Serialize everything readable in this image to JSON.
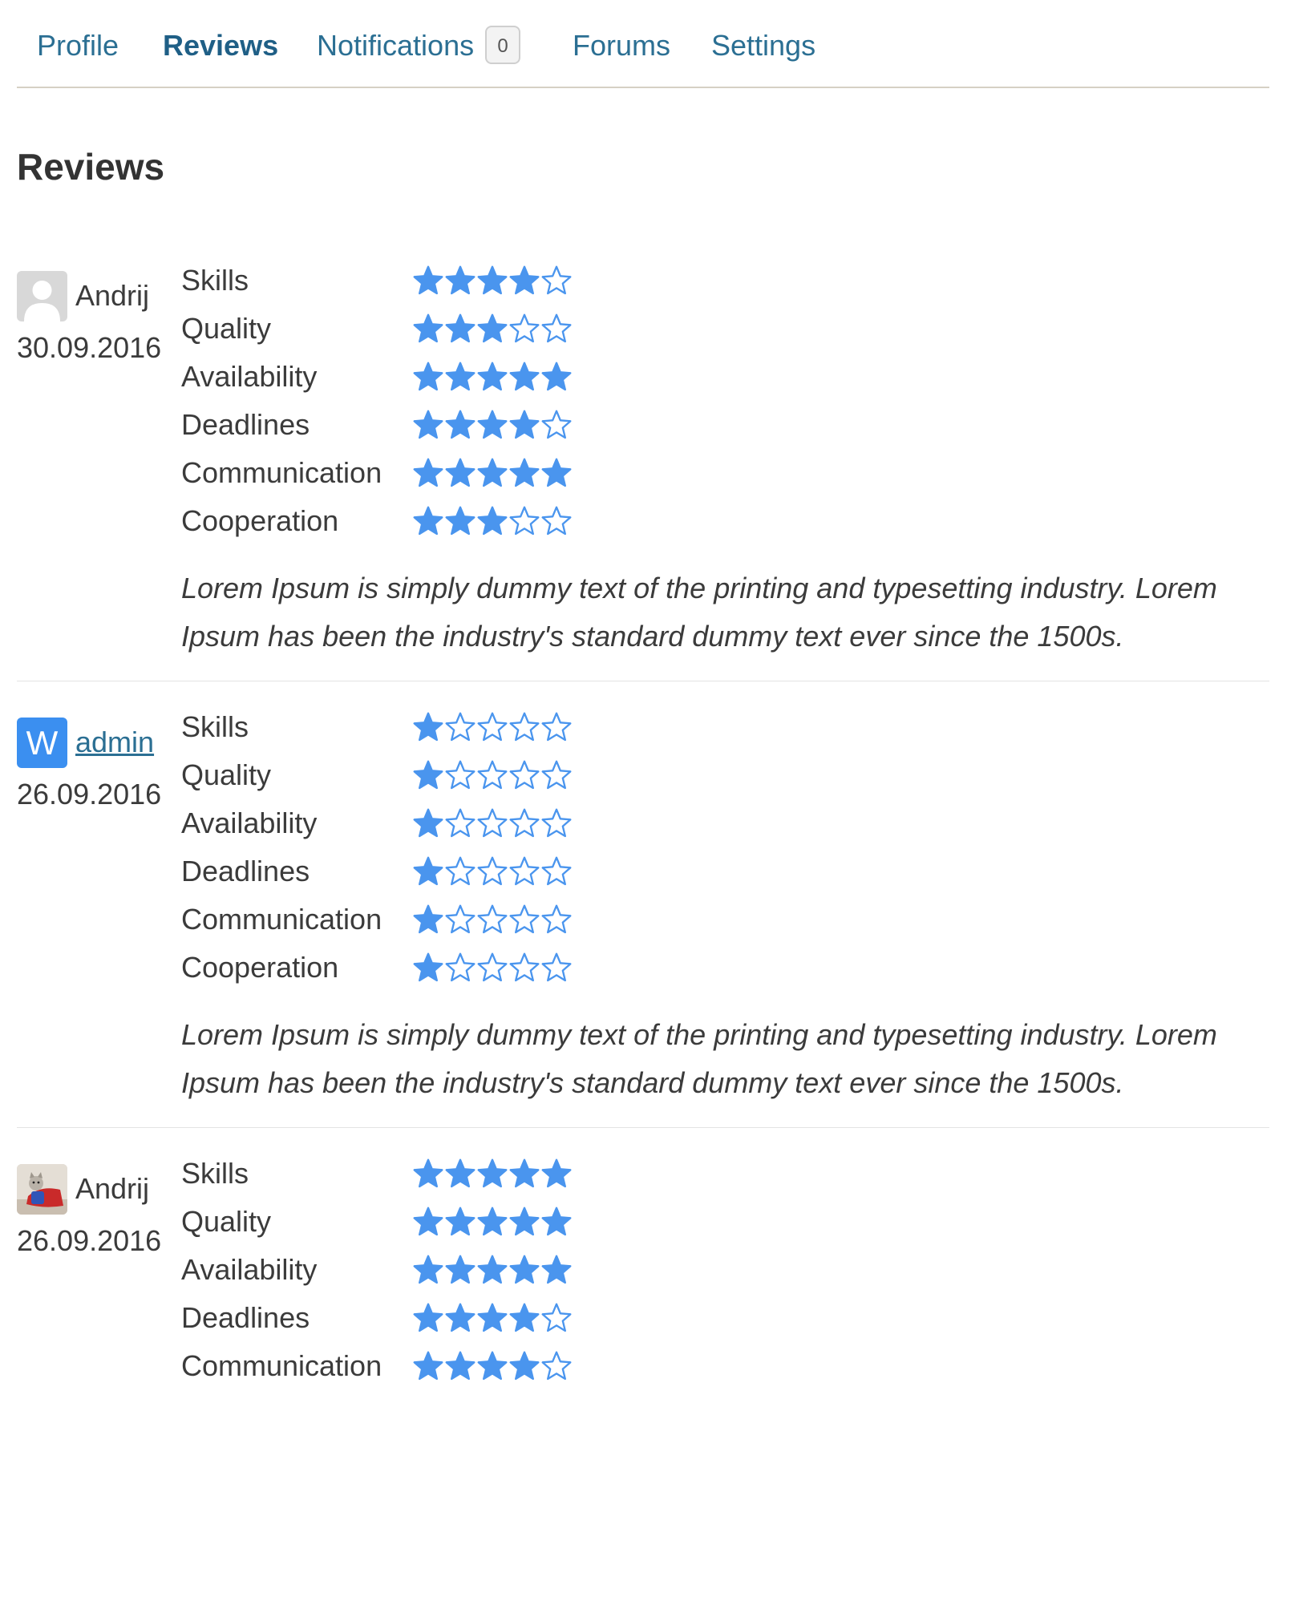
{
  "tabs": [
    {
      "label": "Profile",
      "active": false
    },
    {
      "label": "Reviews",
      "active": true
    },
    {
      "label": "Notifications",
      "active": false,
      "badge": "0"
    },
    {
      "label": "Forums",
      "active": false
    },
    {
      "label": "Settings",
      "active": false
    }
  ],
  "page_title": "Reviews",
  "star_color": "#4a95ee",
  "max_stars": 5,
  "criteria_labels": [
    "Skills",
    "Quality",
    "Availability",
    "Deadlines",
    "Communication",
    "Cooperation"
  ],
  "reviews": [
    {
      "author": "Andrij",
      "author_is_link": false,
      "avatar": {
        "type": "default-user-icon"
      },
      "date": "30.09.2016",
      "ratings": [
        {
          "label": "Skills",
          "value": 4
        },
        {
          "label": "Quality",
          "value": 3
        },
        {
          "label": "Availability",
          "value": 5
        },
        {
          "label": "Deadlines",
          "value": 4
        },
        {
          "label": "Communication",
          "value": 5
        },
        {
          "label": "Cooperation",
          "value": 3
        }
      ],
      "comment": "Lorem Ipsum is simply dummy text of the printing and typesetting industry. Lorem Ipsum has been the industry's standard dummy text ever since the 1500s."
    },
    {
      "author": "admin",
      "author_is_link": true,
      "avatar": {
        "type": "letter",
        "letter": "W",
        "color": "#3b8ff0"
      },
      "date": "26.09.2016",
      "ratings": [
        {
          "label": "Skills",
          "value": 1
        },
        {
          "label": "Quality",
          "value": 1
        },
        {
          "label": "Availability",
          "value": 1
        },
        {
          "label": "Deadlines",
          "value": 1
        },
        {
          "label": "Communication",
          "value": 1
        },
        {
          "label": "Cooperation",
          "value": 1
        }
      ],
      "comment": "Lorem Ipsum is simply dummy text of the printing and typesetting industry. Lorem Ipsum has been the industry's standard dummy text ever since the 1500s."
    },
    {
      "author": "Andrij",
      "author_is_link": false,
      "avatar": {
        "type": "photo-cat-in-costume"
      },
      "date": "26.09.2016",
      "ratings": [
        {
          "label": "Skills",
          "value": 5
        },
        {
          "label": "Quality",
          "value": 5
        },
        {
          "label": "Availability",
          "value": 5
        },
        {
          "label": "Deadlines",
          "value": 4
        },
        {
          "label": "Communication",
          "value": 4
        }
      ],
      "comment": ""
    }
  ]
}
